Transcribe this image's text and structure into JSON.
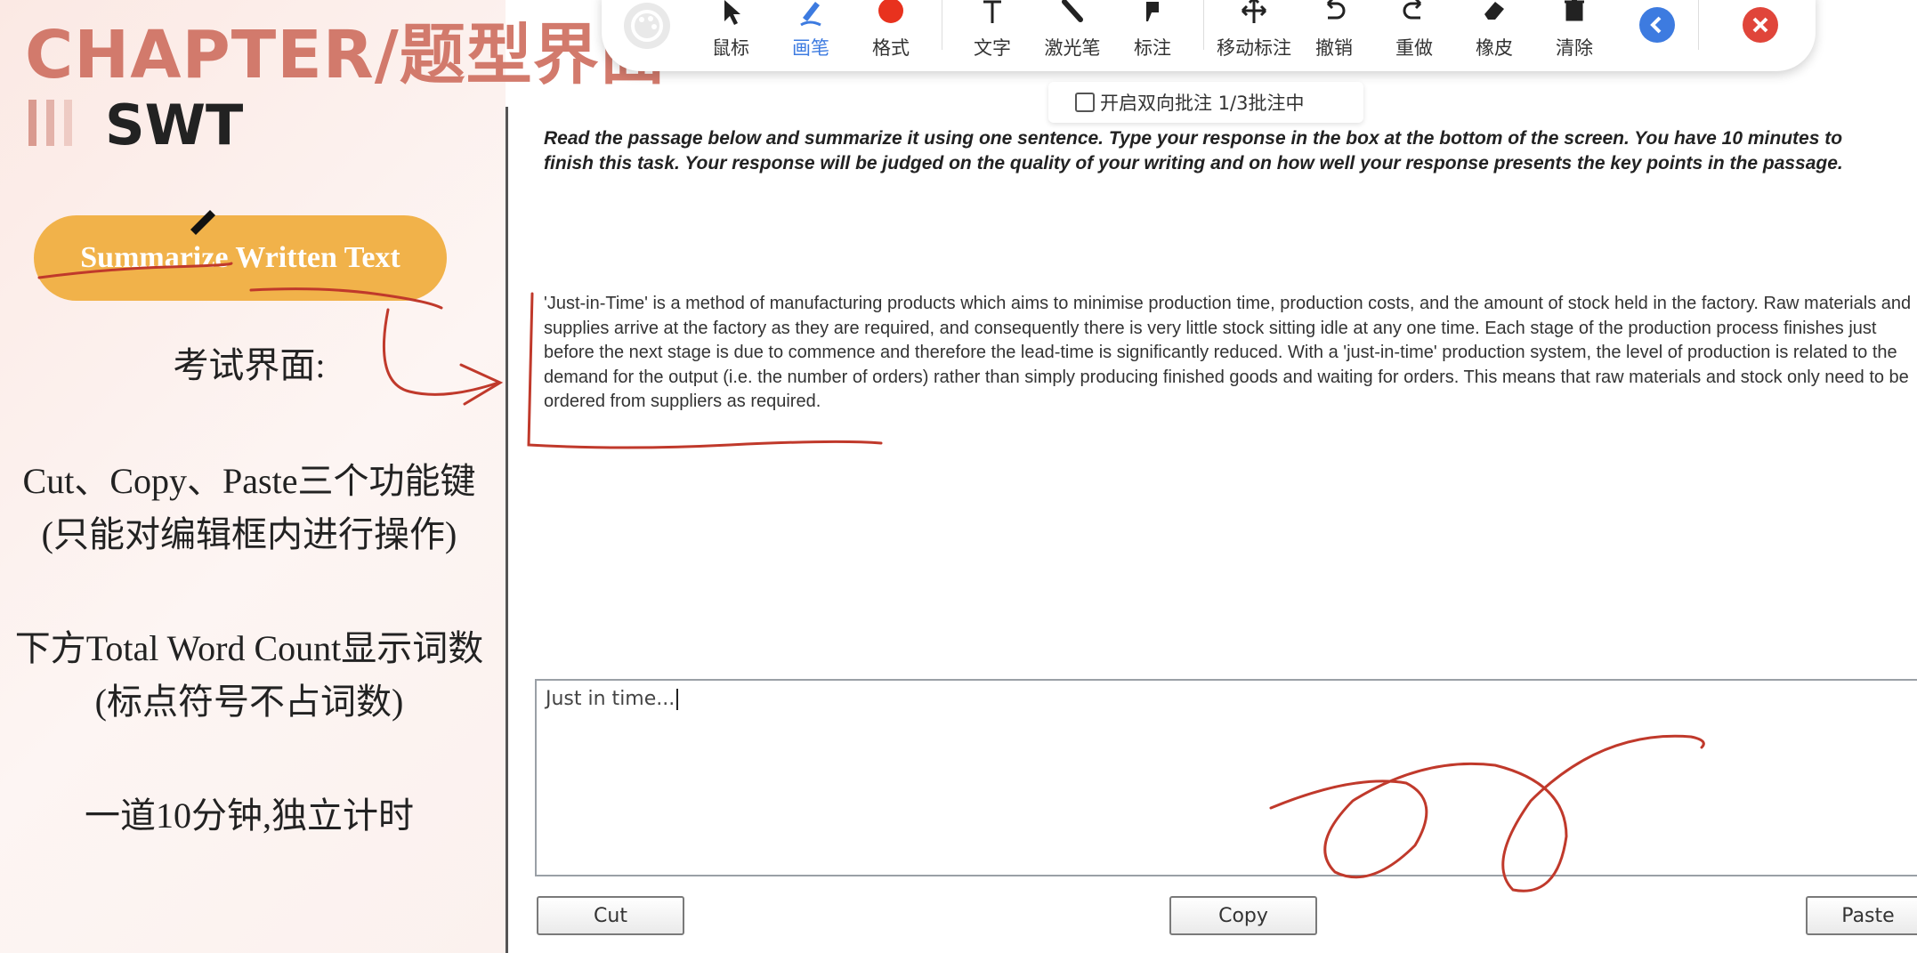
{
  "slide": {
    "chapter_title": "CHAPTER/题型界面",
    "section": "SWT",
    "task_button": "Summarize Written Text",
    "label_exam_ui": "考试界面:",
    "functions_line1": "Cut、Copy、Paste三个功能键",
    "functions_line2": "(只能对编辑框内进行操作)",
    "wordcount_line1": "下方Total Word Count显示词数",
    "wordcount_line2": "(标点符号不占词数)",
    "timing": "一道10分钟,独立计时"
  },
  "toolbar": {
    "tools": [
      {
        "label": "鼠标",
        "icon": "cursor-icon"
      },
      {
        "label": "画笔",
        "icon": "pen-icon",
        "active": true
      },
      {
        "label": "格式",
        "icon": "color-dot-icon"
      },
      {
        "label": "文字",
        "icon": "text-icon"
      },
      {
        "label": "激光笔",
        "icon": "laser-pointer-icon"
      },
      {
        "label": "标注",
        "icon": "marker-icon"
      },
      {
        "label": "移动标注",
        "icon": "move-icon"
      },
      {
        "label": "撤销",
        "icon": "undo-icon"
      },
      {
        "label": "重做",
        "icon": "redo-icon"
      },
      {
        "label": "橡皮",
        "icon": "eraser-icon"
      },
      {
        "label": "清除",
        "icon": "trash-icon"
      }
    ],
    "accent_color": "#3d7be0",
    "format_color": "#e8321e",
    "close_color": "#e0453a",
    "subbar_text": "开启双向批注 1/3批注中"
  },
  "exam": {
    "instructions": "Read the passage below and summarize it using one sentence. Type your response in the box at the bottom of the screen. You have 10 minutes to finish this task. Your response will be judged on the quality of your writing and on how well your response presents the key points in the passage.",
    "passage": "'Just-in-Time' is a method of manufacturing products which aims to minimise production time, production costs, and the amount of stock held in the factory. Raw materials and supplies arrive at the factory as they are required, and consequently there is very little stock sitting idle at any one time. Each stage of the production process finishes just before the next stage is due to commence and therefore the lead-time is significantly reduced. With a 'just-in-time' production system, the level of production is related to the demand for the output (i.e. the number of orders) rather than simply producing finished goods and waiting for orders. This means that raw materials and stock only need to be ordered from suppliers as required.",
    "response_value": "Just in time...",
    "buttons": {
      "cut": "Cut",
      "copy": "Copy",
      "paste": "Paste"
    }
  },
  "annotation_color": "#c0392b"
}
